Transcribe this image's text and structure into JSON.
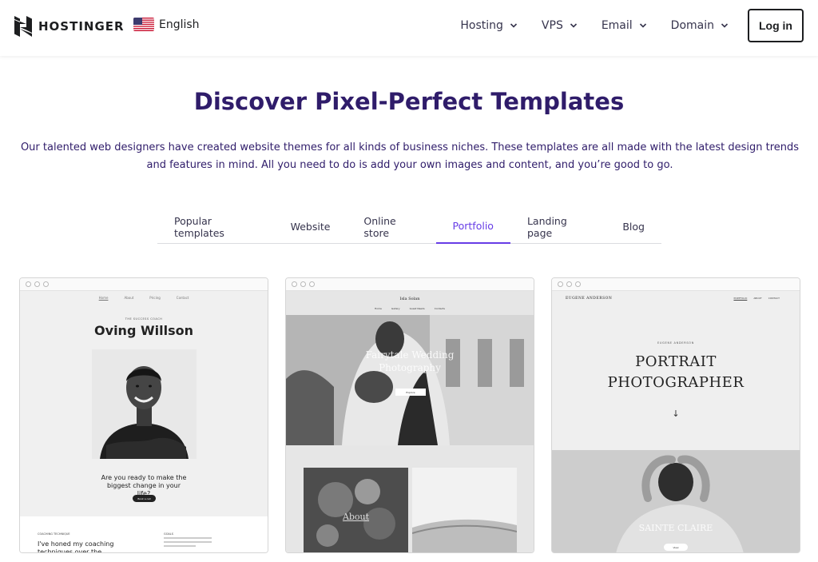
{
  "header": {
    "brand": "HOSTINGER",
    "language": "English",
    "nav": [
      {
        "label": "Hosting"
      },
      {
        "label": "VPS"
      },
      {
        "label": "Email"
      },
      {
        "label": "Domain"
      }
    ],
    "login_label": "Log in"
  },
  "hero": {
    "title": "Discover Pixel-Perfect Templates",
    "subtitle": "Our talented web designers have created website themes for all kinds of business niches. These templates are all made with the latest design trends and features in mind. All you need to do is add your own images and content, and you’re good to go."
  },
  "tabs": [
    {
      "label": "Popular templates",
      "active": false
    },
    {
      "label": "Website",
      "active": false
    },
    {
      "label": "Online store",
      "active": false
    },
    {
      "label": "Portfolio",
      "active": true
    },
    {
      "label": "Landing page",
      "active": false
    },
    {
      "label": "Blog",
      "active": false
    }
  ],
  "templates": {
    "card1": {
      "nav": [
        "Home",
        "About",
        "Pricing",
        "Contact"
      ],
      "tagline": "THE SUCCESS COACH",
      "name": "Oving Willson",
      "question": "Are you ready to make the biggest change in your life?",
      "button": "Book a call",
      "label_left": "COACHING TECHNIQUE",
      "label_right": "GOALS",
      "lower_text": "I've honed my coaching techniques over the"
    },
    "card2": {
      "brand": "Isla Solan",
      "nav": [
        "Home",
        "Gallery",
        "Guest Needs",
        "Contacts"
      ],
      "title": "Fairytale Wedding Photography",
      "button": "Explore",
      "about": "About"
    },
    "card3": {
      "brand": "EUGENE ANDERSON",
      "nav": [
        "PORTFOLIO",
        "ABOUT",
        "CONTACT"
      ],
      "small": "EUGENE ANDERSON",
      "title": "PORTRAIT PHOTOGRAPHER",
      "arrow": "↓",
      "caption": "SAINTE CLAIRE",
      "button": "View"
    }
  },
  "colors": {
    "brand_dark": "#2f1c6a",
    "accent": "#673de6",
    "text": "#36344d"
  },
  "icons": {
    "logo": "hostinger-logo-icon",
    "flag": "us-flag-icon",
    "chevron": "chevron-down-icon",
    "arrow": "arrow-down-icon"
  }
}
